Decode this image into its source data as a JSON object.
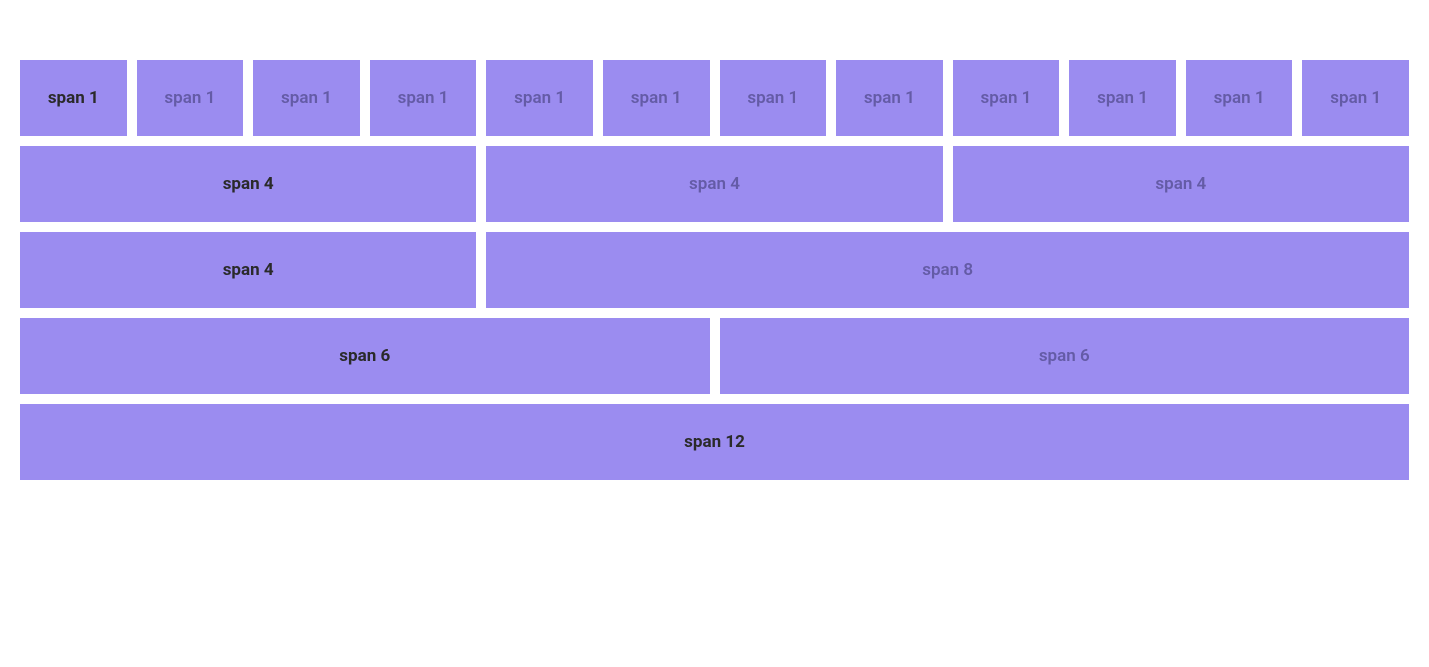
{
  "rows": [
    {
      "cells": [
        {
          "label": "span 1",
          "span": 1,
          "primary": true
        },
        {
          "label": "span 1",
          "span": 1,
          "primary": false
        },
        {
          "label": "span 1",
          "span": 1,
          "primary": false
        },
        {
          "label": "span 1",
          "span": 1,
          "primary": false
        },
        {
          "label": "span 1",
          "span": 1,
          "primary": false
        },
        {
          "label": "span 1",
          "span": 1,
          "primary": false
        },
        {
          "label": "span 1",
          "span": 1,
          "primary": false
        },
        {
          "label": "span 1",
          "span": 1,
          "primary": false
        },
        {
          "label": "span 1",
          "span": 1,
          "primary": false
        },
        {
          "label": "span 1",
          "span": 1,
          "primary": false
        },
        {
          "label": "span 1",
          "span": 1,
          "primary": false
        },
        {
          "label": "span 1",
          "span": 1,
          "primary": false
        }
      ]
    },
    {
      "cells": [
        {
          "label": "span 4",
          "span": 4,
          "primary": true
        },
        {
          "label": "span 4",
          "span": 4,
          "primary": false
        },
        {
          "label": "span 4",
          "span": 4,
          "primary": false
        }
      ]
    },
    {
      "cells": [
        {
          "label": "span 4",
          "span": 4,
          "primary": true
        },
        {
          "label": "span 8",
          "span": 8,
          "primary": false
        }
      ]
    },
    {
      "cells": [
        {
          "label": "span 6",
          "span": 6,
          "primary": true
        },
        {
          "label": "span 6",
          "span": 6,
          "primary": false
        }
      ]
    },
    {
      "cells": [
        {
          "label": "span 12",
          "span": 12,
          "primary": true
        }
      ]
    }
  ]
}
